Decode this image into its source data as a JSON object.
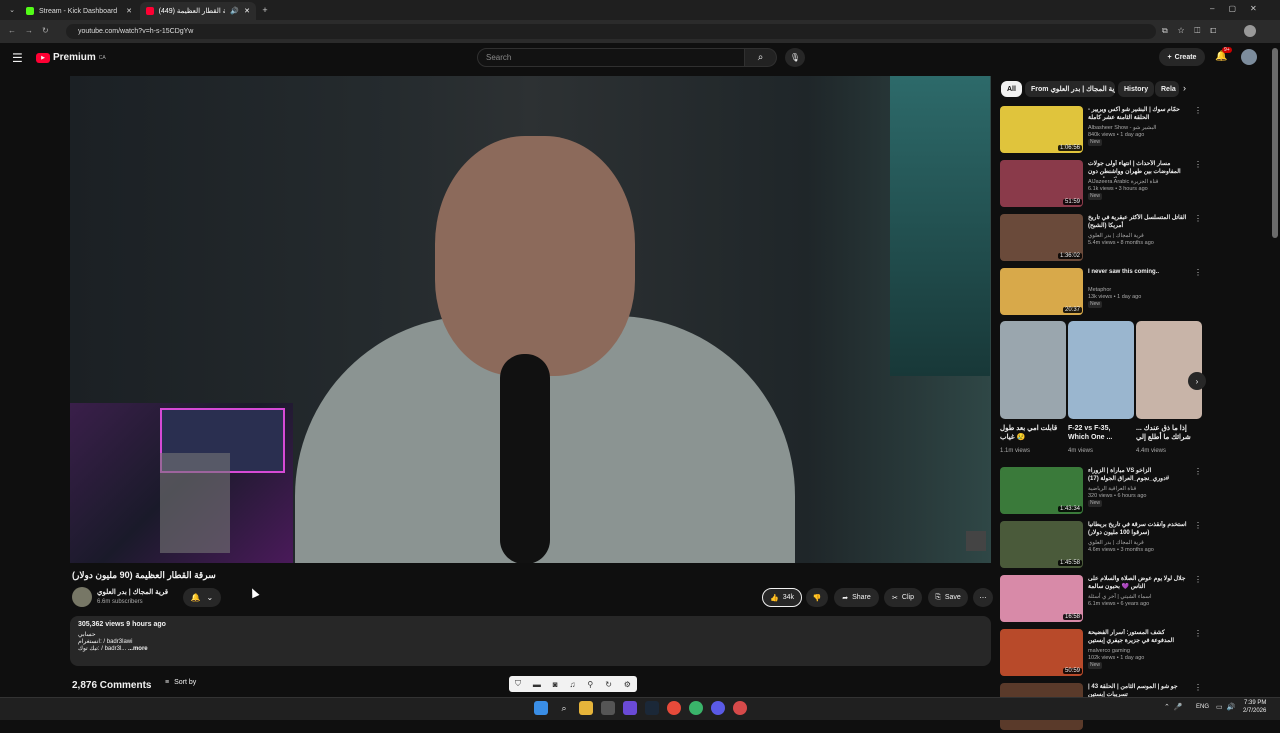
{
  "browser": {
    "tabs": [
      {
        "title": "Stream - Kick Dashboard",
        "active": false
      },
      {
        "title": "(449) سرقة القطار العظيمة",
        "active": true
      }
    ],
    "url": "youtube.com/watch?v=h-s-15CDgYw"
  },
  "header": {
    "logo": "Premium",
    "logo_region": "CA",
    "search_placeholder": "Search",
    "create_label": "Create",
    "notif_count": "9+"
  },
  "video": {
    "title": "سرقة القطار العظيمة (90 مليون دولار)",
    "channel": "قرية المجاك | بدر العلوي",
    "subscribers": "6.6m subscribers",
    "likes": "34k",
    "share_label": "Share",
    "clip_label": "Clip",
    "save_label": "Save"
  },
  "description": {
    "stats": "305,362 views  9 hours ago",
    "line1": "حسابي",
    "line2": "انستغرام: / badr3lawi",
    "line3": "تيك توك: / badr3l...",
    "more": "...more"
  },
  "comments": {
    "count_label": "2,876 Comments",
    "sort_label": "Sort by"
  },
  "chips": [
    "All",
    "From قرية المجاك | بدر العلوي",
    "History",
    "Rela"
  ],
  "recommendations": [
    {
      "title": "حمّام سوك | البشير شو اكس ويريير - الحلقة الثامنة عشر كاملة",
      "channel": "Albasheer Show - البشير شو",
      "meta": "840k views • 1 day ago",
      "badge": "New",
      "duration": "1:06:56",
      "color": "#e0c43c"
    },
    {
      "title": "مسار الأحداث | انتهاء أولى جولات المفاوضات بين طهران وواشنطن دون نتائج ملموسة",
      "channel": "AlJazeera Arabic قناة الجزيرة",
      "meta": "6.1k views • 3 hours ago",
      "badge": "New",
      "duration": "51:59",
      "color": "#8a3a4a"
    },
    {
      "title": "القاتل المتسلسل الأكثر عبقرية في تاريخ أمريكا (الشبح)",
      "channel": "قرية المجاك | بدر العلوي",
      "meta": "5.4m views • 8 months ago",
      "badge": "",
      "duration": "1:36:02",
      "color": "#6a4a3a"
    },
    {
      "title": "I never saw this coming..",
      "channel": "Metaphor",
      "meta": "13k views • 1 day ago",
      "badge": "New",
      "duration": "20:37",
      "color": "#d8a94a"
    }
  ],
  "shorts": [
    {
      "title": "قابلت امي بعد طول غياب 😢",
      "views": "1.1m views",
      "color": "#9aa6ae"
    },
    {
      "title": "F-22 vs F-35, Which One ...",
      "views": "4m views",
      "color": "#9ab6cf"
    },
    {
      "title": "إذا ما ذق عندك ... شرائك ما أطلع إلي",
      "views": "4.4m views",
      "color": "#c8b4a8"
    }
  ],
  "recommendations2": [
    {
      "title": "مباراة | الزوراء VS الزاخو #دوري_نجوم_العراق الجولة (17)",
      "channel": "قناة العراقية الرياضية",
      "meta": "320 views • 6 hours ago",
      "badge": "New",
      "duration": "1:43:34",
      "color": "#3a7a3a"
    },
    {
      "title": "استخدم وأنقذت سرقة في تاريخ بريطانيا (سرقوا 100 مليون دولار)",
      "channel": "قرية المجاك | بدر العلوي",
      "meta": "4.6m views • 3 months ago",
      "badge": "",
      "duration": "1:45:58",
      "color": "#4a5a3a"
    },
    {
      "title": "جلال لولا يوم عوض الصلاة والسلام على الناس 💜 بحبون سالمة",
      "channel": "اسماء الشيتي | آخر ي أسئلة",
      "meta": "6.1m views • 6 years ago",
      "badge": "",
      "duration": "16:58",
      "color": "#d88aa8"
    },
    {
      "title": "كشف المستور: أسرار الفضيحة المدفوعة في جزيرة جيفري إبستين",
      "channel": "malverco gaming",
      "meta": "102k views • 1 day ago",
      "badge": "New",
      "duration": "50:59",
      "color": "#b84a2a"
    },
    {
      "title": "جو شو | الموسم الثامن | الحلقة 43 | تسريبات إبستين",
      "channel": "",
      "meta": "",
      "badge": "",
      "duration": "",
      "color": "#5a3a2a"
    }
  ],
  "taskbar": {
    "lang": "ENG",
    "time": "7:39 PM",
    "date": "2/7/2026"
  },
  "colors": {
    "accent_red": "#ff0033",
    "bg": "#0f0f0f"
  }
}
